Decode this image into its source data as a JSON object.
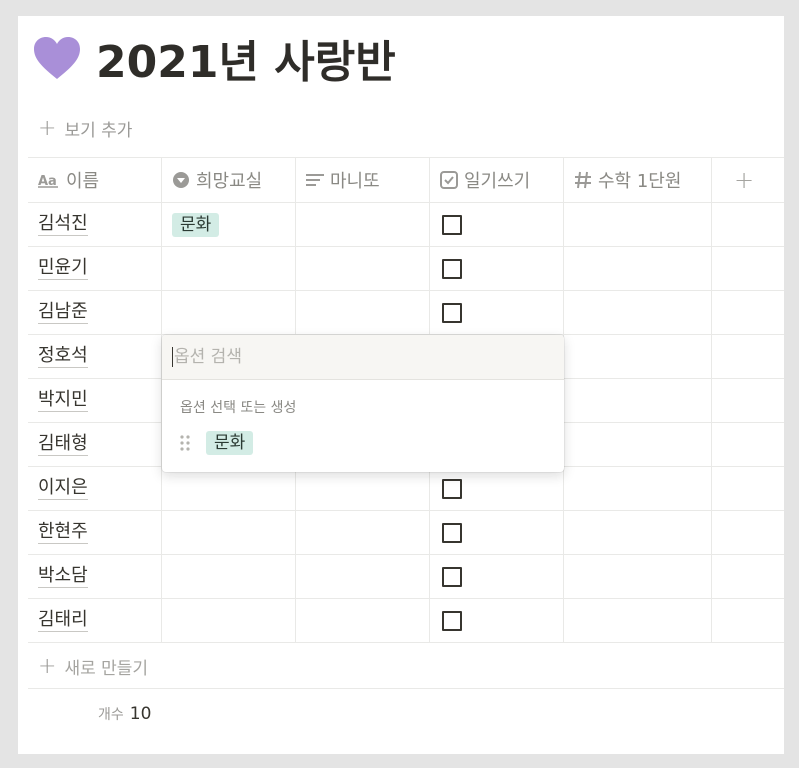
{
  "page": {
    "title": "2021년 사랑반",
    "icon": "purple-heart-icon",
    "accent_heart": "#a98fd8"
  },
  "toolbar": {
    "add_view_label": "보기 추가"
  },
  "table": {
    "columns": [
      {
        "label": "이름",
        "icon": "text-aa-icon"
      },
      {
        "label": "희망교실",
        "icon": "select-icon"
      },
      {
        "label": "마니또",
        "icon": "text-lines-icon"
      },
      {
        "label": "일기쓰기",
        "icon": "checkbox-icon"
      },
      {
        "label": "수학 1단원",
        "icon": "number-hash-icon"
      }
    ],
    "rows": [
      {
        "name": "김석진",
        "hope": "문화",
        "diary": false
      },
      {
        "name": "민윤기",
        "hope": "",
        "diary": false
      },
      {
        "name": "김남준",
        "hope": "",
        "diary": false
      },
      {
        "name": "정호석",
        "hope": "",
        "diary": false
      },
      {
        "name": "박지민",
        "hope": "",
        "diary": false
      },
      {
        "name": "김태형",
        "hope": "",
        "diary": false
      },
      {
        "name": "이지은",
        "hope": "",
        "diary": false
      },
      {
        "name": "한현주",
        "hope": "",
        "diary": false
      },
      {
        "name": "박소담",
        "hope": "",
        "diary": false
      },
      {
        "name": "김태리",
        "hope": "",
        "diary": false
      }
    ],
    "new_row_label": "새로 만들기",
    "count_label": "개수",
    "count_value": "10"
  },
  "popup": {
    "search_placeholder": "옵션 검색",
    "subtitle": "옵션 선택 또는 생성",
    "options": [
      {
        "label": "문화",
        "color": "#d3ece5"
      }
    ]
  }
}
